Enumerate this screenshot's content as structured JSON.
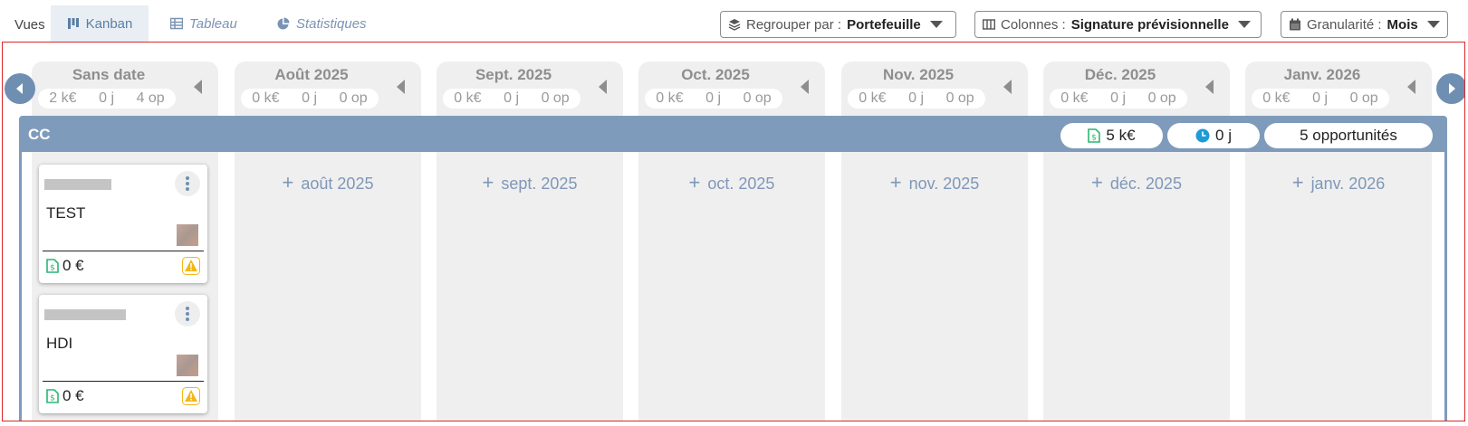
{
  "views": {
    "label": "Vues",
    "tabs": [
      {
        "label": "Kanban",
        "icon": "kanban-icon",
        "active": true
      },
      {
        "label": "Tableau",
        "icon": "table-icon",
        "active": false
      },
      {
        "label": "Statistiques",
        "icon": "pie-chart-icon",
        "active": false
      }
    ]
  },
  "toolbar": {
    "group_by": {
      "label": "Regrouper par :",
      "value": "Portefeuille",
      "icon": "layers-icon"
    },
    "columns": {
      "label": "Colonnes :",
      "value": "Signature prévisionnelle",
      "icon": "columns-icon"
    },
    "granularity": {
      "label": "Granularité :",
      "value": "Mois",
      "icon": "calendar-icon"
    }
  },
  "colors": {
    "accent": "#6f8fb2",
    "group_header": "#7f9bbb",
    "column_bg": "#efefef",
    "green_icon": "#2bb673",
    "clock_icon": "#1e9bd7",
    "warning": "#f2b619",
    "frame": "#d92828"
  },
  "columns": [
    {
      "title": "Sans date",
      "amount": "2 k€",
      "days": "0 j",
      "ops": "4 op",
      "add_label": ""
    },
    {
      "title": "Août 2025",
      "amount": "0 k€",
      "days": "0 j",
      "ops": "0 op",
      "add_label": "août 2025"
    },
    {
      "title": "Sept. 2025",
      "amount": "0 k€",
      "days": "0 j",
      "ops": "0 op",
      "add_label": "sept. 2025"
    },
    {
      "title": "Oct. 2025",
      "amount": "0 k€",
      "days": "0 j",
      "ops": "0 op",
      "add_label": "oct. 2025"
    },
    {
      "title": "Nov. 2025",
      "amount": "0 k€",
      "days": "0 j",
      "ops": "0 op",
      "add_label": "nov. 2025"
    },
    {
      "title": "Déc. 2025",
      "amount": "0 k€",
      "days": "0 j",
      "ops": "0 op",
      "add_label": "déc. 2025"
    },
    {
      "title": "Janv. 2026",
      "amount": "0 k€",
      "days": "0 j",
      "ops": "0 op",
      "add_label": "janv. 2026"
    }
  ],
  "group": {
    "name": "CC",
    "amount": "5 k€",
    "days": "0 j",
    "opportunities": "5 opportunités"
  },
  "cards": [
    {
      "title": "TEST",
      "amount": "0 €"
    },
    {
      "title": "HDI",
      "amount": "0 €"
    }
  ]
}
